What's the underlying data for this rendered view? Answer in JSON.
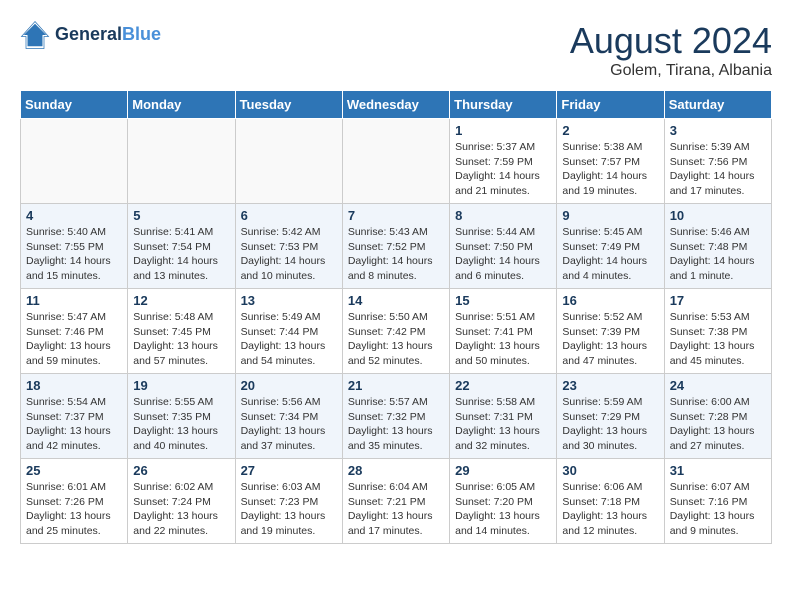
{
  "header": {
    "logo_line1": "General",
    "logo_line2": "Blue",
    "month_year": "August 2024",
    "location": "Golem, Tirana, Albania"
  },
  "days_of_week": [
    "Sunday",
    "Monday",
    "Tuesday",
    "Wednesday",
    "Thursday",
    "Friday",
    "Saturday"
  ],
  "weeks": [
    [
      {
        "day": "",
        "info": ""
      },
      {
        "day": "",
        "info": ""
      },
      {
        "day": "",
        "info": ""
      },
      {
        "day": "",
        "info": ""
      },
      {
        "day": "1",
        "info": "Sunrise: 5:37 AM\nSunset: 7:59 PM\nDaylight: 14 hours\nand 21 minutes."
      },
      {
        "day": "2",
        "info": "Sunrise: 5:38 AM\nSunset: 7:57 PM\nDaylight: 14 hours\nand 19 minutes."
      },
      {
        "day": "3",
        "info": "Sunrise: 5:39 AM\nSunset: 7:56 PM\nDaylight: 14 hours\nand 17 minutes."
      }
    ],
    [
      {
        "day": "4",
        "info": "Sunrise: 5:40 AM\nSunset: 7:55 PM\nDaylight: 14 hours\nand 15 minutes."
      },
      {
        "day": "5",
        "info": "Sunrise: 5:41 AM\nSunset: 7:54 PM\nDaylight: 14 hours\nand 13 minutes."
      },
      {
        "day": "6",
        "info": "Sunrise: 5:42 AM\nSunset: 7:53 PM\nDaylight: 14 hours\nand 10 minutes."
      },
      {
        "day": "7",
        "info": "Sunrise: 5:43 AM\nSunset: 7:52 PM\nDaylight: 14 hours\nand 8 minutes."
      },
      {
        "day": "8",
        "info": "Sunrise: 5:44 AM\nSunset: 7:50 PM\nDaylight: 14 hours\nand 6 minutes."
      },
      {
        "day": "9",
        "info": "Sunrise: 5:45 AM\nSunset: 7:49 PM\nDaylight: 14 hours\nand 4 minutes."
      },
      {
        "day": "10",
        "info": "Sunrise: 5:46 AM\nSunset: 7:48 PM\nDaylight: 14 hours\nand 1 minute."
      }
    ],
    [
      {
        "day": "11",
        "info": "Sunrise: 5:47 AM\nSunset: 7:46 PM\nDaylight: 13 hours\nand 59 minutes."
      },
      {
        "day": "12",
        "info": "Sunrise: 5:48 AM\nSunset: 7:45 PM\nDaylight: 13 hours\nand 57 minutes."
      },
      {
        "day": "13",
        "info": "Sunrise: 5:49 AM\nSunset: 7:44 PM\nDaylight: 13 hours\nand 54 minutes."
      },
      {
        "day": "14",
        "info": "Sunrise: 5:50 AM\nSunset: 7:42 PM\nDaylight: 13 hours\nand 52 minutes."
      },
      {
        "day": "15",
        "info": "Sunrise: 5:51 AM\nSunset: 7:41 PM\nDaylight: 13 hours\nand 50 minutes."
      },
      {
        "day": "16",
        "info": "Sunrise: 5:52 AM\nSunset: 7:39 PM\nDaylight: 13 hours\nand 47 minutes."
      },
      {
        "day": "17",
        "info": "Sunrise: 5:53 AM\nSunset: 7:38 PM\nDaylight: 13 hours\nand 45 minutes."
      }
    ],
    [
      {
        "day": "18",
        "info": "Sunrise: 5:54 AM\nSunset: 7:37 PM\nDaylight: 13 hours\nand 42 minutes."
      },
      {
        "day": "19",
        "info": "Sunrise: 5:55 AM\nSunset: 7:35 PM\nDaylight: 13 hours\nand 40 minutes."
      },
      {
        "day": "20",
        "info": "Sunrise: 5:56 AM\nSunset: 7:34 PM\nDaylight: 13 hours\nand 37 minutes."
      },
      {
        "day": "21",
        "info": "Sunrise: 5:57 AM\nSunset: 7:32 PM\nDaylight: 13 hours\nand 35 minutes."
      },
      {
        "day": "22",
        "info": "Sunrise: 5:58 AM\nSunset: 7:31 PM\nDaylight: 13 hours\nand 32 minutes."
      },
      {
        "day": "23",
        "info": "Sunrise: 5:59 AM\nSunset: 7:29 PM\nDaylight: 13 hours\nand 30 minutes."
      },
      {
        "day": "24",
        "info": "Sunrise: 6:00 AM\nSunset: 7:28 PM\nDaylight: 13 hours\nand 27 minutes."
      }
    ],
    [
      {
        "day": "25",
        "info": "Sunrise: 6:01 AM\nSunset: 7:26 PM\nDaylight: 13 hours\nand 25 minutes."
      },
      {
        "day": "26",
        "info": "Sunrise: 6:02 AM\nSunset: 7:24 PM\nDaylight: 13 hours\nand 22 minutes."
      },
      {
        "day": "27",
        "info": "Sunrise: 6:03 AM\nSunset: 7:23 PM\nDaylight: 13 hours\nand 19 minutes."
      },
      {
        "day": "28",
        "info": "Sunrise: 6:04 AM\nSunset: 7:21 PM\nDaylight: 13 hours\nand 17 minutes."
      },
      {
        "day": "29",
        "info": "Sunrise: 6:05 AM\nSunset: 7:20 PM\nDaylight: 13 hours\nand 14 minutes."
      },
      {
        "day": "30",
        "info": "Sunrise: 6:06 AM\nSunset: 7:18 PM\nDaylight: 13 hours\nand 12 minutes."
      },
      {
        "day": "31",
        "info": "Sunrise: 6:07 AM\nSunset: 7:16 PM\nDaylight: 13 hours\nand 9 minutes."
      }
    ]
  ]
}
